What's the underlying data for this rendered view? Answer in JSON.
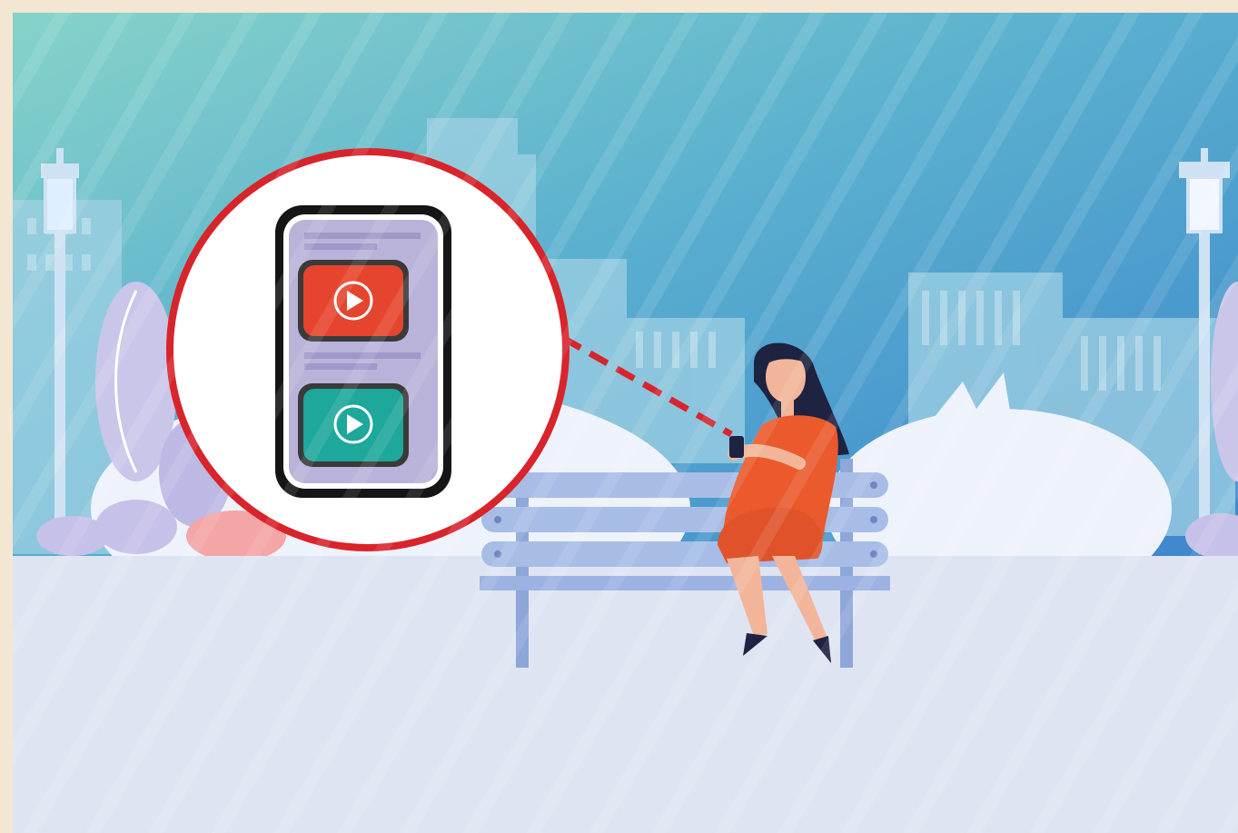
{
  "scene": {
    "description_none": "",
    "icons": [
      "zoom-circle",
      "phone",
      "video-play-icon",
      "video-play-icon",
      "street-lamp",
      "park-bench",
      "woman-with-phone"
    ],
    "colors": {
      "frame": "#f3e6d3",
      "sky_top_left": "#7fd0cc",
      "sky_bottom_right": "#3f8fd0",
      "ground": "#dfe4f3",
      "zoom_ring": "#d8242b",
      "video_red": "#e5452e",
      "video_teal": "#1ea79b",
      "phone_screen": "#b9b3d9",
      "bench": "#9fb3e0",
      "dress": "#ea5a2c",
      "hair": "#1d2340"
    }
  }
}
